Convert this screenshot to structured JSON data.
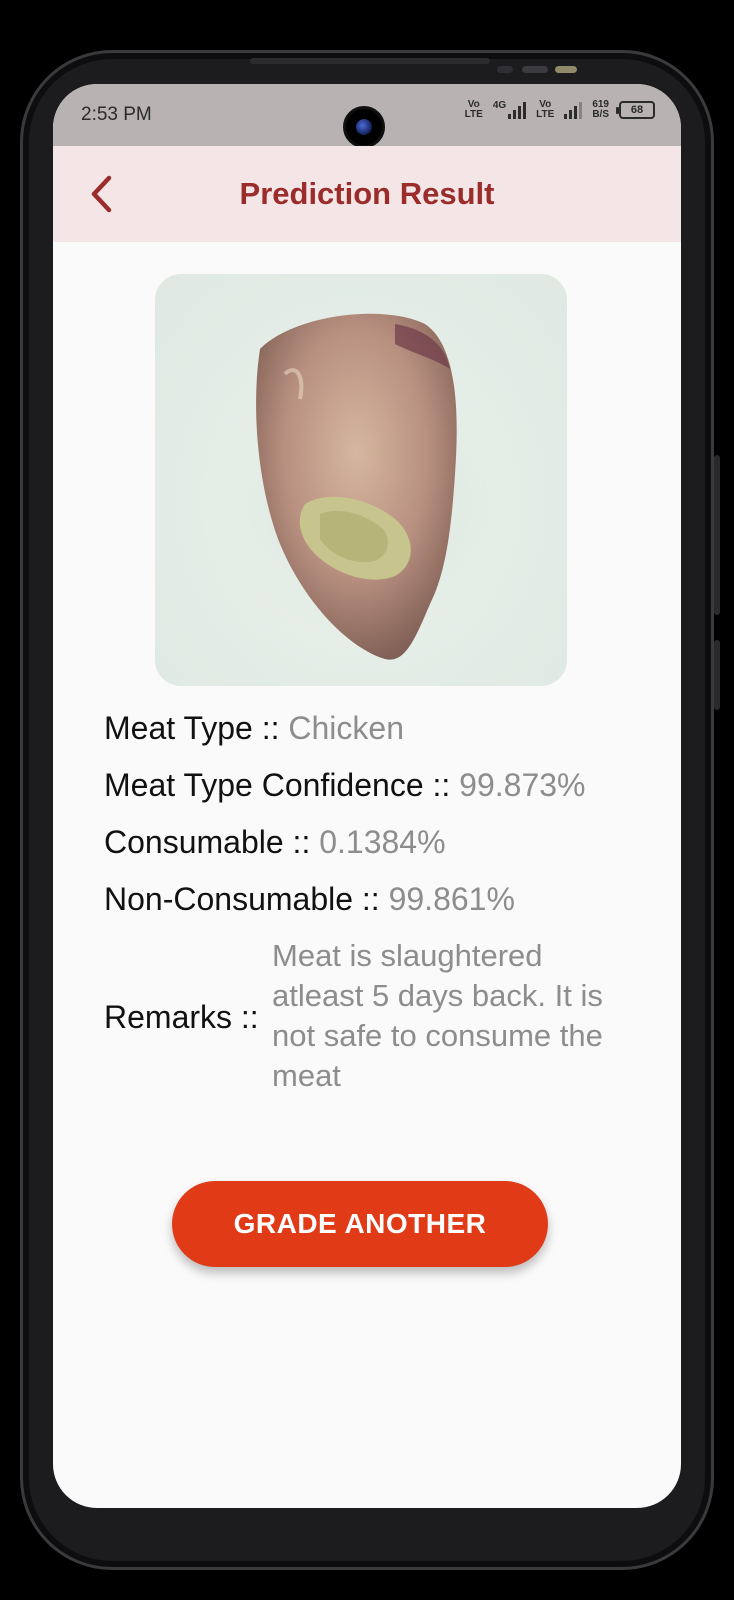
{
  "status_bar": {
    "time": "2:53 PM",
    "sim1_top": "Vo",
    "sim1_bottom": "LTE",
    "network_type": "4G",
    "sim2_top": "Vo",
    "sim2_bottom": "LTE",
    "speed_value": "619",
    "speed_unit": "B/S",
    "battery": "68"
  },
  "header": {
    "back_icon": "chevron-left-icon",
    "title": "Prediction Result"
  },
  "result": {
    "image_subject": "chicken meat sample photo",
    "meat_type_label": "Meat Type :: ",
    "meat_type_value": "Chicken",
    "confidence_label": "Meat Type Confidence :: ",
    "confidence_value": "99.873%",
    "consumable_label": "Consumable :: ",
    "consumable_value": "0.1384%",
    "non_consumable_label": "Non-Consumable :: ",
    "non_consumable_value": "99.861%",
    "remarks_label": "Remarks ::",
    "remarks_value": "Meat is slaughtered atleast 5 days back. It is not safe to consume the meat"
  },
  "actions": {
    "grade_another_label": "GRADE ANOTHER"
  },
  "colors": {
    "accent": "#9b2c2c",
    "app_bar_bg": "#f4e6e6",
    "button_bg": "#e03a17",
    "value_text": "#8d8d8d"
  }
}
